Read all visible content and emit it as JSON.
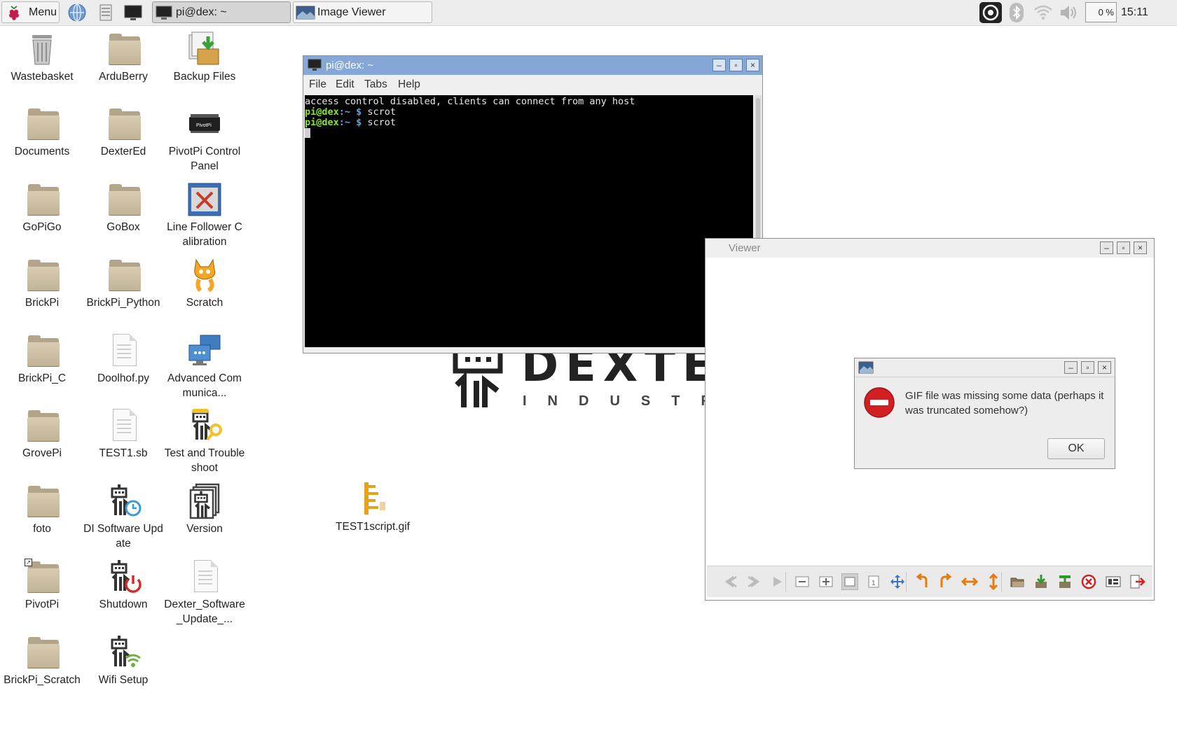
{
  "taskbar": {
    "menu_label": "Menu",
    "tasks": [
      {
        "label": "pi@dex: ~",
        "active": true
      },
      {
        "label": "Image Viewer",
        "active": false
      }
    ],
    "cpu_label": "0 %",
    "clock": "15:11"
  },
  "desktop_icons": [
    {
      "label": "Wastebasket",
      "icon": "trash-icon"
    },
    {
      "label": "ArduBerry",
      "icon": "folder-icon"
    },
    {
      "label": "Backup Files",
      "icon": "backup-icon"
    },
    {
      "label": "Documents",
      "icon": "folder-icon"
    },
    {
      "label": "DexterEd",
      "icon": "folder-icon"
    },
    {
      "label": "PivotPi Control Panel",
      "icon": "pivotpi-board-icon"
    },
    {
      "label": "GoPiGo",
      "icon": "folder-icon"
    },
    {
      "label": "GoBox",
      "icon": "folder-icon"
    },
    {
      "label": "Line Follower Calibration",
      "icon": "tools-icon"
    },
    {
      "label": "BrickPi",
      "icon": "folder-icon"
    },
    {
      "label": "BrickPi_Python",
      "icon": "folder-icon"
    },
    {
      "label": "Scratch",
      "icon": "scratch-cat-icon"
    },
    {
      "label": "BrickPi_C",
      "icon": "folder-icon"
    },
    {
      "label": "Doolhof.py",
      "icon": "document-icon"
    },
    {
      "label": "Advanced Communica...",
      "icon": "network-icon"
    },
    {
      "label": "GrovePi",
      "icon": "folder-icon"
    },
    {
      "label": "TEST1.sb",
      "icon": "document-icon"
    },
    {
      "label": "Test and Troubleshoot",
      "icon": "robot-wrench-icon"
    },
    {
      "label": "foto",
      "icon": "folder-icon"
    },
    {
      "label": "DI Software Update",
      "icon": "robot-clock-icon"
    },
    {
      "label": "Version",
      "icon": "robot-stack-icon"
    },
    {
      "label": "PivotPi",
      "icon": "folder-icon"
    },
    {
      "label": "Shutdown",
      "icon": "robot-power-icon"
    },
    {
      "label": "Dexter_Software_Update_...",
      "icon": "document-icon"
    },
    {
      "label": "BrickPi_Scratch",
      "icon": "folder-icon"
    },
    {
      "label": "Wifi Setup",
      "icon": "robot-wifi-icon"
    },
    {
      "label": "TEST1script.gif",
      "icon": "gif-file-icon"
    }
  ],
  "terminal": {
    "title": "pi@dex: ~",
    "menu": [
      "File",
      "Edit",
      "Tabs",
      "Help"
    ],
    "lines": [
      {
        "text": "access control disabled, clients can connect from any host"
      },
      {
        "user": "pi@dex",
        "dir": ":~ $ ",
        "cmd": "scrot"
      },
      {
        "user": "pi@dex",
        "dir": ":~ $ ",
        "cmd": "scrot"
      }
    ]
  },
  "image_viewer": {
    "title": "Viewer"
  },
  "wallpaper": {
    "logo_text": "DEXTE",
    "logo_sub": "INDUSTRI"
  },
  "dialog": {
    "message": "GIF file was missing some data (perhaps it was truncated somehow?)",
    "ok_label": "OK"
  },
  "colors": {
    "terminal_title": "#86a8d8",
    "prompt_user": "#8ae234",
    "prompt_dir": "#729fcf",
    "error_red": "#d21f24"
  }
}
